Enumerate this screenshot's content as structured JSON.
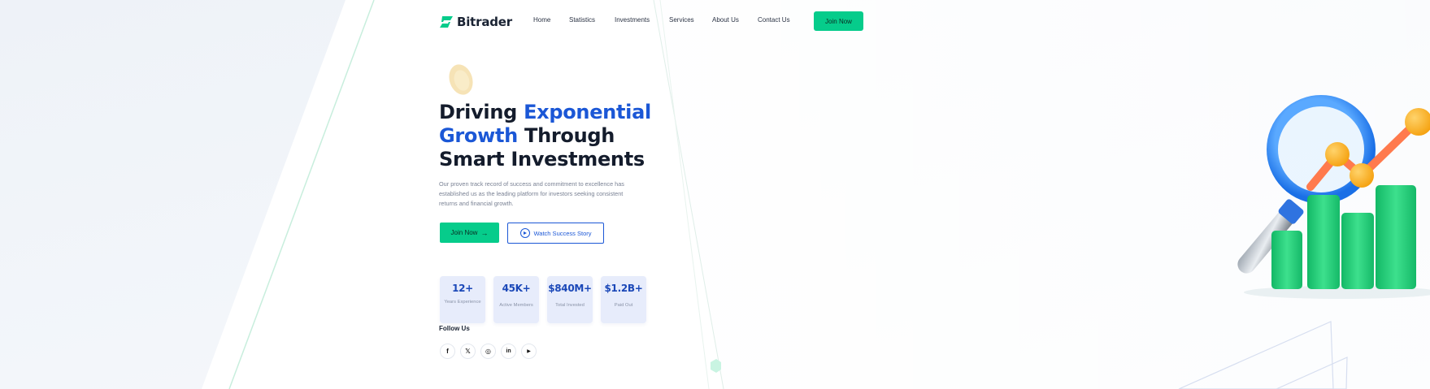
{
  "brand": {
    "name": "Bitrader",
    "accent_green": "#06cc8b",
    "accent_blue": "#1b57d6",
    "logo_icon": "bitrader-logo-icon"
  },
  "nav": {
    "items": [
      {
        "label": "Home"
      },
      {
        "label": "Statistics"
      },
      {
        "label": "Investments"
      },
      {
        "label": "Services"
      },
      {
        "label": "About Us"
      },
      {
        "label": "Contact Us"
      }
    ],
    "cta_label": "Join Now"
  },
  "hero": {
    "title_part1": "Driving ",
    "title_highlight1": "Exponential",
    "title_highlight2": "Growth",
    "title_part2": " Through",
    "title_line3": "Smart Investments",
    "description": "Our proven track record of success and commitment to excellence has established us as the leading platform for investors seeking consistent returns and financial growth.",
    "primary_button": "Join Now",
    "secondary_button": "Watch Success Story"
  },
  "stats": [
    {
      "value": "12+",
      "label": "Years Experience"
    },
    {
      "value": "45K+",
      "label": "Active Members"
    },
    {
      "value": "$840M+",
      "label": "Total Invested"
    },
    {
      "value": "$1.2B+",
      "label": "Paid Out"
    }
  ],
  "follow": {
    "title": "Follow Us",
    "icons": [
      "facebook-icon",
      "twitter-icon",
      "instagram-icon",
      "linkedin-icon",
      "youtube-icon"
    ],
    "glyphs": [
      "f",
      "𝕏",
      "◎",
      "in",
      "▶"
    ]
  }
}
